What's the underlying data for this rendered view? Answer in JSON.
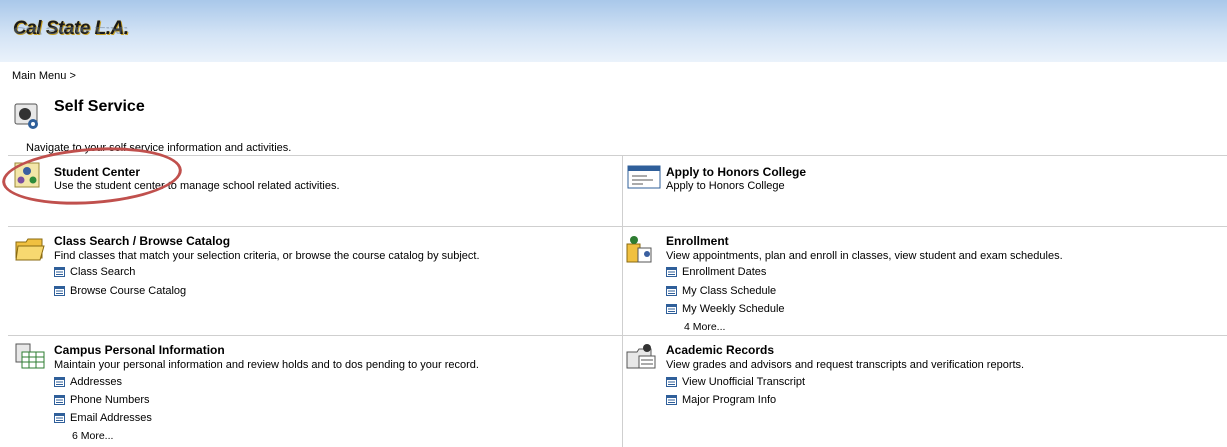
{
  "header": {
    "logo_text": "Cal State L.A."
  },
  "breadcrumb": "Main Menu >",
  "page": {
    "title": "Self Service",
    "subtitle": "Navigate to your self service information and activities."
  },
  "cards": {
    "student_center": {
      "title": "Student Center",
      "desc": "Use the student center to manage school related activities."
    },
    "honors": {
      "title": "Apply to Honors College",
      "desc": "Apply to Honors College"
    },
    "class_search": {
      "title": "Class Search / Browse Catalog",
      "desc": "Find classes that match your selection criteria, or browse the course catalog by subject.",
      "links": [
        "Class Search",
        "Browse Course Catalog"
      ]
    },
    "enrollment": {
      "title": "Enrollment",
      "desc": "View appointments, plan and enroll in classes, view student and exam schedules.",
      "links": [
        "Enrollment Dates",
        "My Class Schedule",
        "My Weekly Schedule"
      ],
      "more": "4 More..."
    },
    "campus_info": {
      "title": "Campus Personal Information",
      "desc": "Maintain your personal information and review holds and to dos pending to your record.",
      "links": [
        "Addresses",
        "Phone Numbers",
        "Email Addresses"
      ],
      "more": "6 More..."
    },
    "academic_records": {
      "title": "Academic Records",
      "desc": "View grades and advisors and request transcripts and verification reports.",
      "links": [
        "View Unofficial Transcript",
        "Major Program Info"
      ]
    }
  },
  "colors": {
    "highlight_circle": "#c0504d",
    "banner_top": "#a9c8ea"
  },
  "icons": [
    "self-service-icon",
    "student-center-icon",
    "form-icon",
    "folder-icon",
    "enrollment-icon",
    "personal-info-icon",
    "records-icon",
    "link-icon"
  ]
}
